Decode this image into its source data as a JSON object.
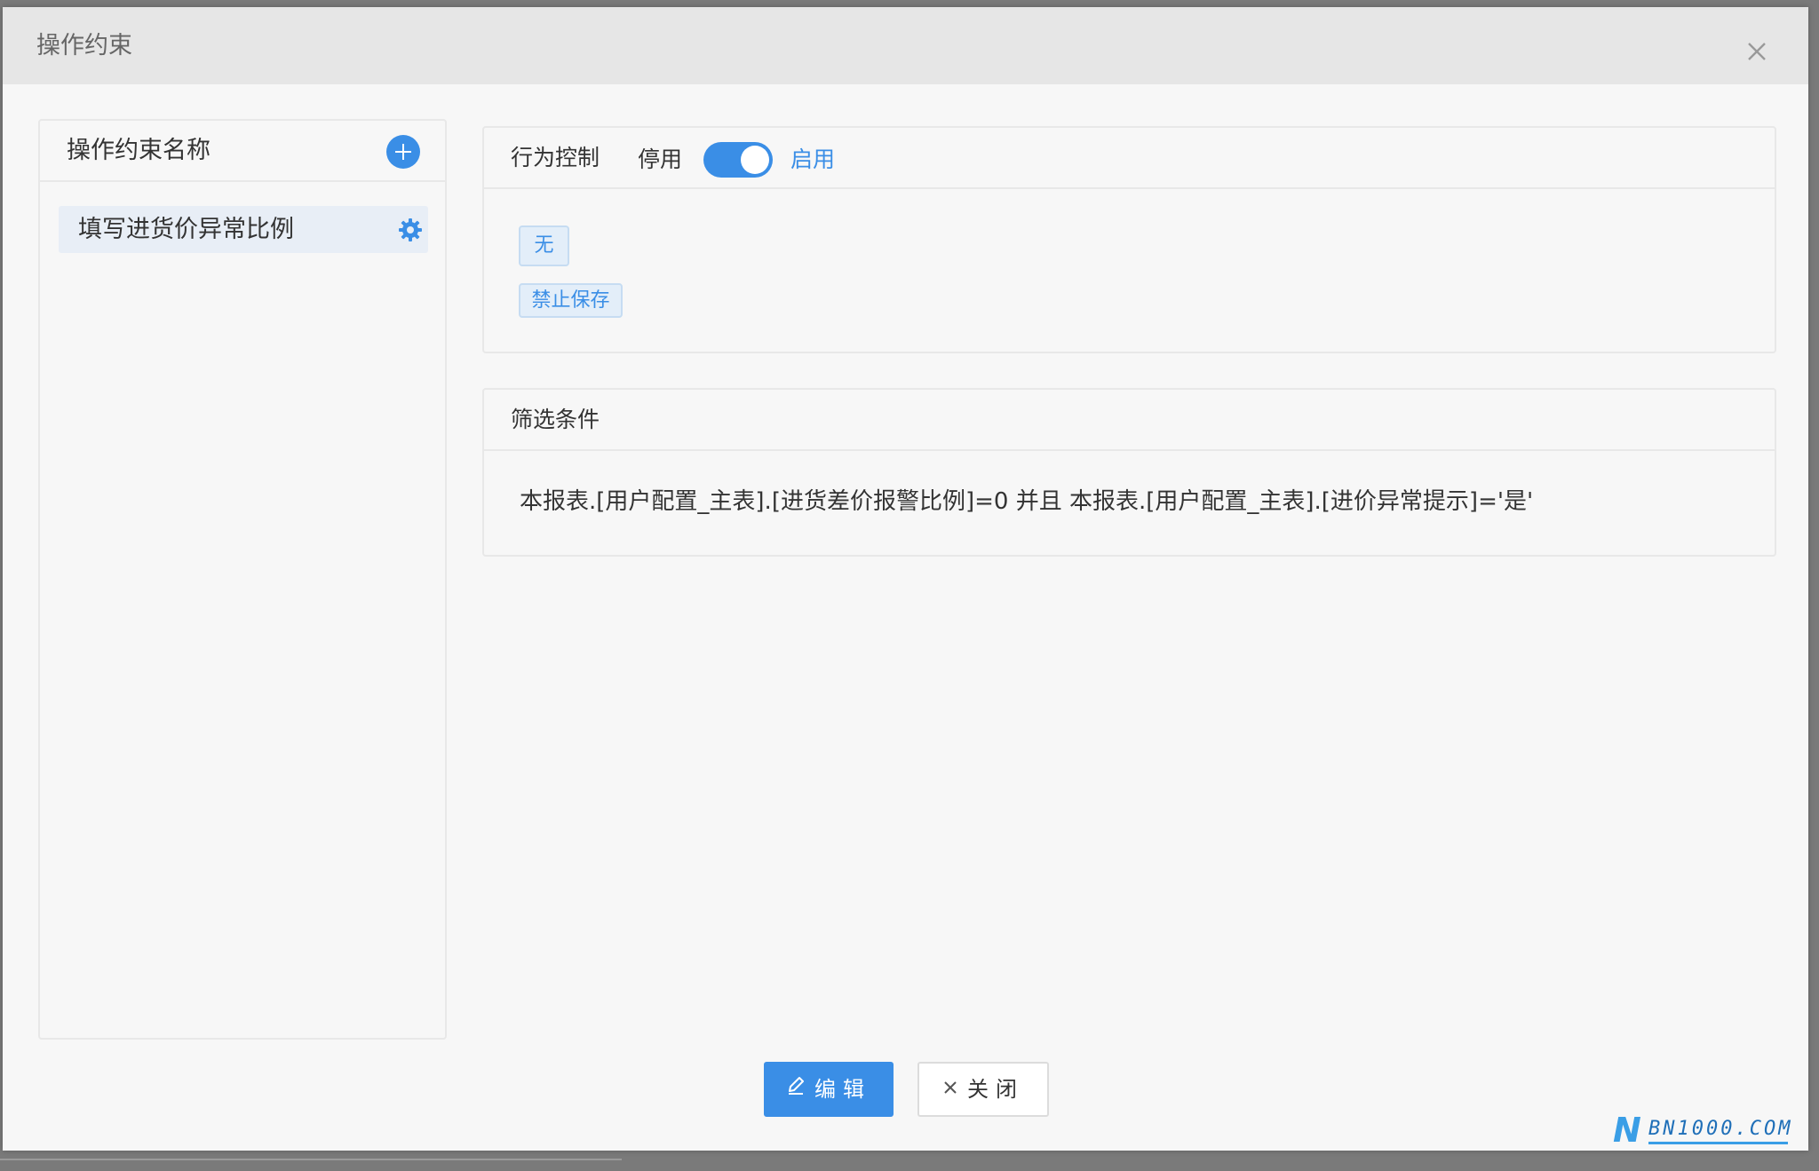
{
  "dialog": {
    "title": "操作约束"
  },
  "left_panel": {
    "title": "操作约束名称",
    "items": [
      {
        "label": "填写进货价异常比例"
      }
    ]
  },
  "behavior": {
    "title": "行为控制",
    "off_label": "停用",
    "on_label": "启用",
    "enabled": true,
    "tags": [
      "无",
      "禁止保存"
    ]
  },
  "filter": {
    "title": "筛选条件",
    "expression": "本报表.[用户配置_主表].[进货差价报警比例]=0 并且 本报表.[用户配置_主表].[进价异常提示]='是'"
  },
  "footer": {
    "edit_label": "编辑",
    "close_label": "关闭"
  },
  "watermark": {
    "letter": "N",
    "text": "BN1000.COM"
  },
  "colors": {
    "accent": "#3a8ee6",
    "header_bg": "#e6e6e6",
    "dialog_bg": "#f7f7f7",
    "tag_bg": "#e3eef9"
  },
  "icons": {
    "close": "close-icon",
    "add": "plus-circle-icon",
    "settings": "gear-icon",
    "edit": "pencil-icon",
    "cancel": "x-icon"
  }
}
